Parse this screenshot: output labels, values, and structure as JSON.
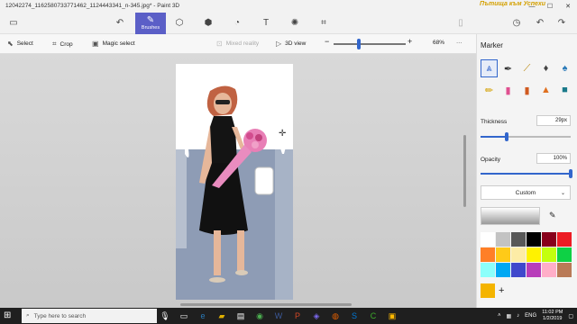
{
  "window": {
    "title": "12042274_1162580733771462_1124443341_n-345.jpg* - Paint 3D",
    "badge": "Пътища към Успехи",
    "minimize": "—",
    "maximize": "☐",
    "close": "✕"
  },
  "ribbon": {
    "brushes_label": "Brushes"
  },
  "toolbar": {
    "select_label": "Select",
    "crop_label": "Crop",
    "magic_select_label": "Magic select",
    "mixed_reality_label": "Mixed reality",
    "view3d_label": "3D view",
    "zoom_minus": "−",
    "zoom_plus": "+",
    "zoom_level": "68%",
    "more": "···"
  },
  "panel": {
    "title": "Marker",
    "thickness_label": "Thickness",
    "thickness_value": "29px",
    "thickness_fraction": 0.29,
    "opacity_label": "Opacity",
    "opacity_value": "100%",
    "opacity_fraction": 1.0,
    "preset_label": "Custom",
    "add_color": "+",
    "palette": [
      "#ffffff",
      "#c3c3c3",
      "#585858",
      "#000000",
      "#88001b",
      "#ec1c24",
      "#ff7f27",
      "#ffca18",
      "#fdeca6",
      "#fff200",
      "#c4ff0e",
      "#0ed145",
      "#8cfffb",
      "#00a8f3",
      "#3f48cc",
      "#b83dba",
      "#ffaec8",
      "#b97a57"
    ],
    "custom_color": "#f4b400"
  },
  "taskbar": {
    "search_placeholder": "Type here to search",
    "language": "ENG",
    "time": "11:02 PM",
    "date": "1/2/2019"
  }
}
